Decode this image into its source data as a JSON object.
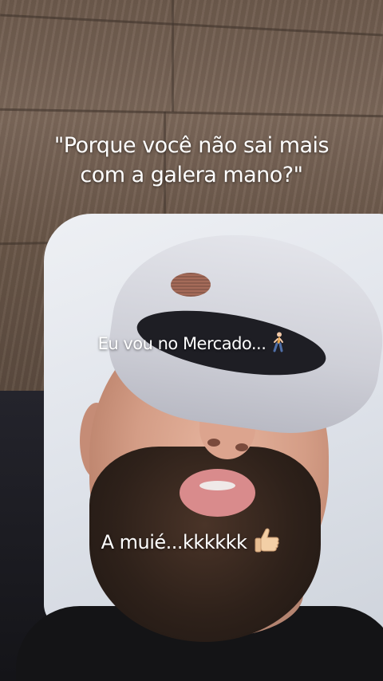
{
  "captions": {
    "top": "\"Porque você não sai mais com a galera mano?\"",
    "top_line1": "\"Porque você não sai mais",
    "top_line2": "com a galera mano?\"",
    "middle": "Eu vou no Mercado...",
    "bottom": "A muié...kkkkkk"
  },
  "emoji": {
    "middle": "walking-person-icon",
    "bottom": "thumbs-up-icon"
  },
  "colors": {
    "caption_text": "#ffffff"
  }
}
